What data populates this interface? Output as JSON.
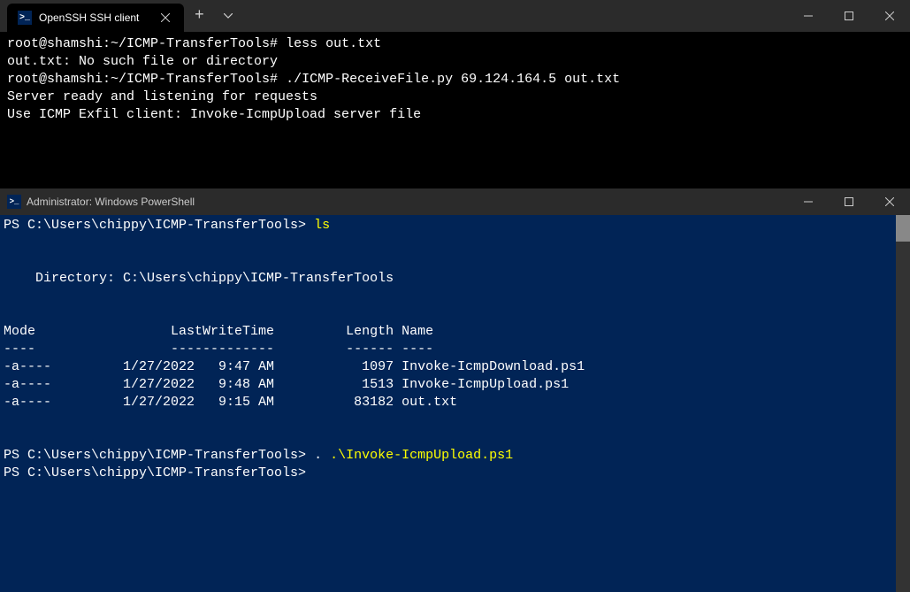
{
  "topWindow": {
    "tabTitle": "OpenSSH SSH client",
    "line1_prompt": "root@shamshi:~/ICMP-TransferTools#",
    "line1_cmd": " less out.txt",
    "line2": "out.txt: No such file or directory",
    "line3_prompt": "root@shamshi:~/ICMP-TransferTools#",
    "line3_cmd": " ./ICMP-ReceiveFile.py 69.124.164.5 out.txt",
    "line4": "Server ready and listening for requests",
    "line5": "Use ICMP Exfil client: Invoke-IcmpUpload server file"
  },
  "bottomWindow": {
    "title": "Administrator: Windows PowerShell",
    "prompt1": "PS C:\\Users\\chippy\\ICMP-TransferTools>",
    "cmd1": " ls",
    "dirLabel": "    Directory: C:\\Users\\chippy\\ICMP-TransferTools",
    "header": "Mode                 LastWriteTime         Length Name",
    "divider": "----                 -------------         ------ ----",
    "row1": "-a----         1/27/2022   9:47 AM           1097 Invoke-IcmpDownload.ps1",
    "row2": "-a----         1/27/2022   9:48 AM           1513 Invoke-IcmpUpload.ps1",
    "row3": "-a----         1/27/2022   9:15 AM          83182 out.txt",
    "prompt2": "PS C:\\Users\\chippy\\ICMP-TransferTools>",
    "cmd2_a": " . ",
    "cmd2_b": ".\\Invoke-IcmpUpload.ps1",
    "prompt3": "PS C:\\Users\\chippy\\ICMP-TransferTools>"
  }
}
